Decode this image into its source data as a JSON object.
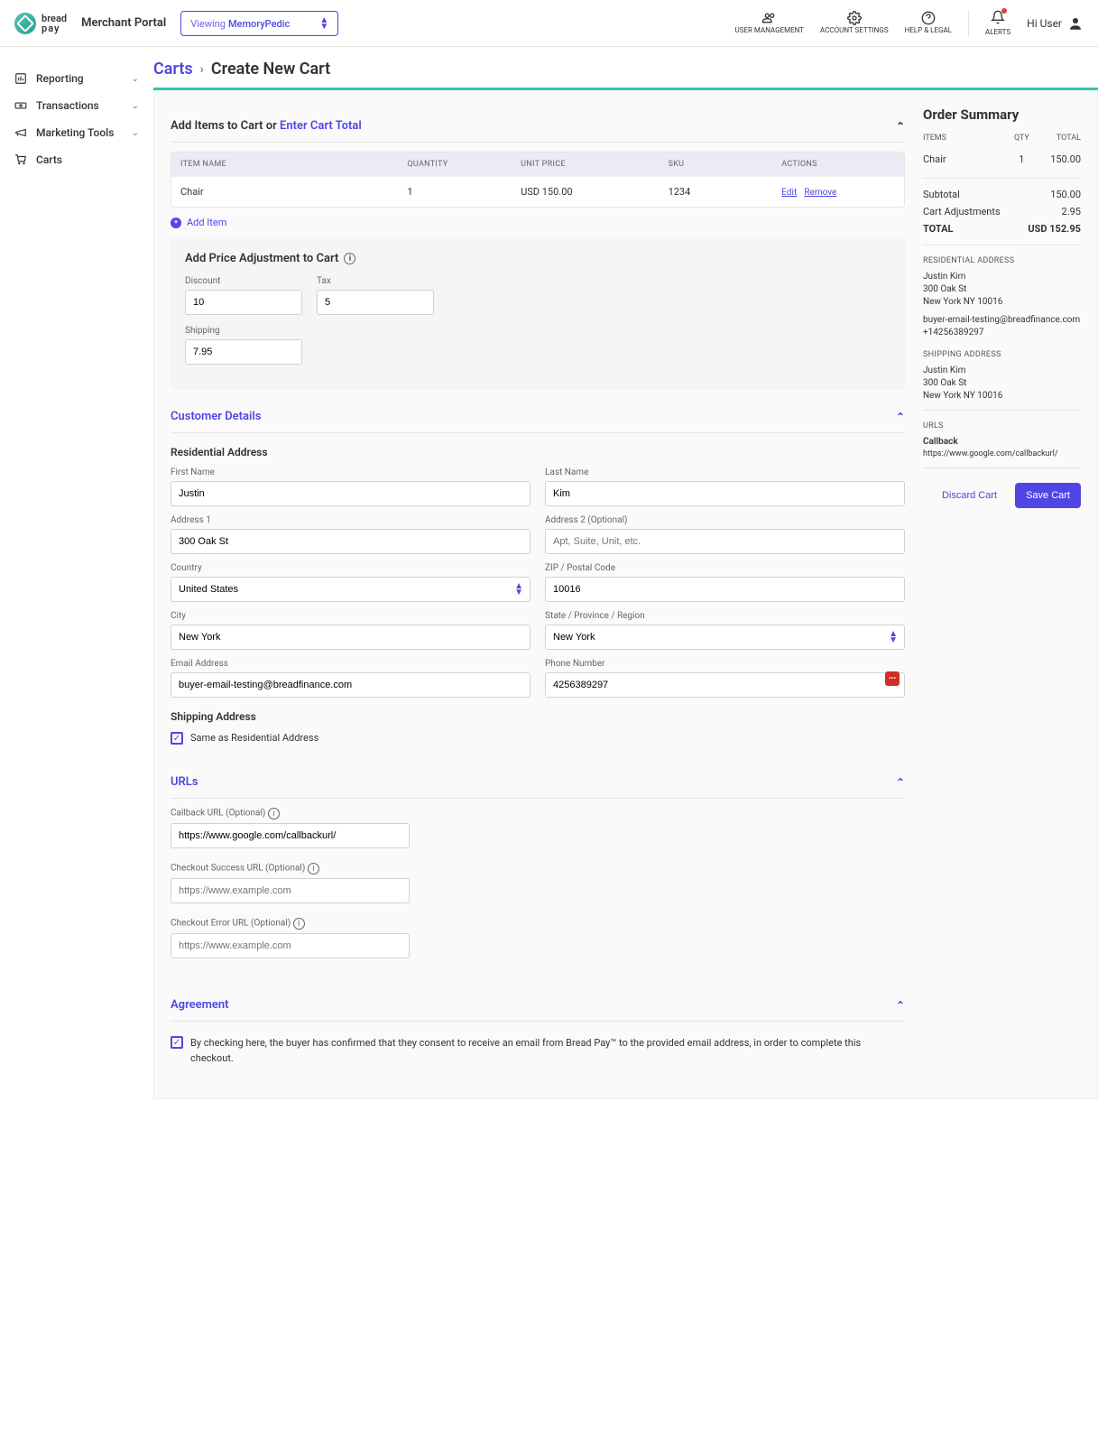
{
  "header": {
    "brand1": "bread",
    "brand2": "pay",
    "portal": "Merchant Portal",
    "viewing_label": "Viewing",
    "viewing_value": "MemoryPedic",
    "top_nav": {
      "user_mgmt": "USER MANAGEMENT",
      "account": "ACCOUNT SETTINGS",
      "help": "HELP & LEGAL",
      "alerts": "ALERTS"
    },
    "greeting": "Hi User"
  },
  "sidebar": {
    "items": [
      {
        "label": "Reporting",
        "expandable": true
      },
      {
        "label": "Transactions",
        "expandable": true
      },
      {
        "label": "Marketing Tools",
        "expandable": true
      },
      {
        "label": "Carts",
        "expandable": false
      }
    ]
  },
  "breadcrumb": {
    "root": "Carts",
    "current": "Create New Cart"
  },
  "addItems": {
    "title_prefix": "Add Items to Cart or ",
    "title_link": "Enter Cart Total",
    "columns": {
      "name": "ITEM NAME",
      "qty": "QUANTITY",
      "price": "UNIT PRICE",
      "sku": "SKU",
      "actions": "ACTIONS"
    },
    "rows": [
      {
        "name": "Chair",
        "qty": "1",
        "price": "USD 150.00",
        "sku": "1234",
        "edit": "Edit",
        "remove": "Remove"
      }
    ],
    "add_item": "Add Item"
  },
  "adjust": {
    "title": "Add Price Adjustment to Cart",
    "discount_label": "Discount",
    "discount_value": "10",
    "tax_label": "Tax",
    "tax_value": "5",
    "shipping_label": "Shipping",
    "shipping_value": "7.95"
  },
  "customer": {
    "title": "Customer Details",
    "res_title": "Residential Address",
    "first_label": "First Name",
    "first_value": "Justin",
    "last_label": "Last Name",
    "last_value": "Kim",
    "addr1_label": "Address 1",
    "addr1_value": "300 Oak St",
    "addr2_label": "Address 2 (Optional)",
    "addr2_placeholder": "Apt, Suite, Unit, etc.",
    "country_label": "Country",
    "country_value": "United States",
    "zip_label": "ZIP / Postal Code",
    "zip_value": "10016",
    "city_label": "City",
    "city_value": "New York",
    "state_label": "State / Province / Region",
    "state_value": "New York",
    "email_label": "Email Address",
    "email_value": "buyer-email-testing@breadfinance.com",
    "phone_label": "Phone Number",
    "phone_value": "4256389297",
    "ship_title": "Shipping Address",
    "same_label": "Same as Residential Address"
  },
  "urls": {
    "title": "URLs",
    "callback_label": "Callback URL (Optional)",
    "callback_value": "https://www.google.com/callbackurl/",
    "success_label": "Checkout Success URL (Optional)",
    "success_placeholder": "https://www.example.com",
    "error_label": "Checkout Error URL (Optional)",
    "error_placeholder": "https://www.example.com"
  },
  "agreement": {
    "title": "Agreement",
    "text": "By checking here, the buyer has confirmed that they consent to receive an email from Bread Pay™ to the provided email address, in order to complete this checkout."
  },
  "summary": {
    "title": "Order Summary",
    "head": {
      "items": "ITEMS",
      "qty": "QTY",
      "total": "TOTAL"
    },
    "rows": [
      {
        "name": "Chair",
        "qty": "1",
        "total": "150.00"
      }
    ],
    "subtotal_label": "Subtotal",
    "subtotal_value": "150.00",
    "adj_label": "Cart Adjustments",
    "adj_value": "2.95",
    "total_label": "TOTAL",
    "total_value": "USD 152.95",
    "res_label": "RESIDENTIAL ADDRESS",
    "res_name": "Justin Kim",
    "res_street": "300 Oak St",
    "res_city": "New York NY 10016",
    "res_email": "buyer-email-testing@breadfinance.com",
    "res_phone": "+14256389297",
    "ship_label": "SHIPPING ADDRESS",
    "ship_name": "Justin Kim",
    "ship_street": "300 Oak St",
    "ship_city": "New York NY 10016",
    "urls_label": "URLS",
    "callback_label": "Callback",
    "callback_value": "https://www.google.com/callbackurl/",
    "discard": "Discard Cart",
    "save": "Save Cart"
  }
}
